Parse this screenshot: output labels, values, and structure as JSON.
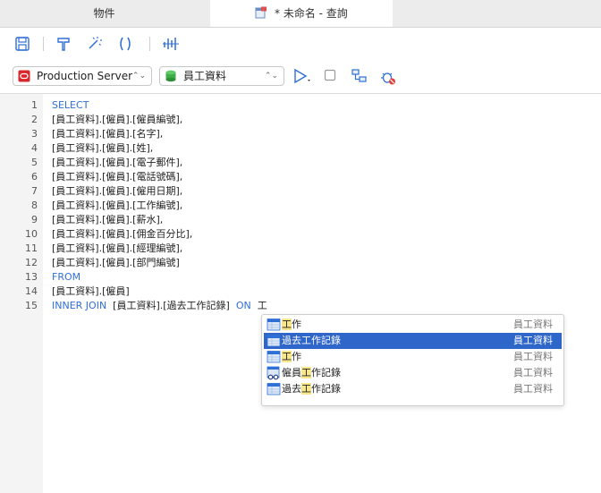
{
  "tabs": {
    "objects": "物件",
    "query": "* 未命名 - 查詢"
  },
  "toolbar": {
    "connection": "Production Server",
    "database": "員工資料"
  },
  "editor": {
    "lines": [
      {
        "num": "1",
        "parts": [
          {
            "t": "SELECT",
            "kw": true
          }
        ]
      },
      {
        "num": "2",
        "parts": [
          {
            "t": "[員工資料].[僱員].[僱員編號],",
            "kw": false
          }
        ]
      },
      {
        "num": "3",
        "parts": [
          {
            "t": "[員工資料].[僱員].[名字],",
            "kw": false
          }
        ]
      },
      {
        "num": "4",
        "parts": [
          {
            "t": "[員工資料].[僱員].[姓],",
            "kw": false
          }
        ]
      },
      {
        "num": "5",
        "parts": [
          {
            "t": "[員工資料].[僱員].[電子郵件],",
            "kw": false
          }
        ]
      },
      {
        "num": "6",
        "parts": [
          {
            "t": "[員工資料].[僱員].[電話號碼],",
            "kw": false
          }
        ]
      },
      {
        "num": "7",
        "parts": [
          {
            "t": "[員工資料].[僱員].[僱用日期],",
            "kw": false
          }
        ]
      },
      {
        "num": "8",
        "parts": [
          {
            "t": "[員工資料].[僱員].[工作編號],",
            "kw": false
          }
        ]
      },
      {
        "num": "9",
        "parts": [
          {
            "t": "[員工資料].[僱員].[薪水],",
            "kw": false
          }
        ]
      },
      {
        "num": "10",
        "parts": [
          {
            "t": "[員工資料].[僱員].[佣金百分比],",
            "kw": false
          }
        ]
      },
      {
        "num": "11",
        "parts": [
          {
            "t": "[員工資料].[僱員].[經理編號],",
            "kw": false
          }
        ]
      },
      {
        "num": "12",
        "parts": [
          {
            "t": "[員工資料].[僱員].[部門編號]",
            "kw": false
          }
        ]
      },
      {
        "num": "13",
        "parts": [
          {
            "t": "FROM",
            "kw": true
          }
        ]
      },
      {
        "num": "14",
        "parts": [
          {
            "t": "[員工資料].[僱員]",
            "kw": false
          }
        ]
      },
      {
        "num": "15",
        "parts": [
          {
            "t": "INNER JOIN",
            "kw": true
          },
          {
            "t": "  [員工資料].[過去工作記錄]  ",
            "kw": false
          },
          {
            "t": "ON",
            "kw": true
          },
          {
            "t": "  工",
            "kw": false
          }
        ]
      }
    ]
  },
  "autocomplete": {
    "items": [
      {
        "pre": "",
        "match": "工",
        "post": "作",
        "schema": "員工資料",
        "icon": "table-icon",
        "selected": false
      },
      {
        "pre": "過去工作記錄",
        "match": "",
        "post": "",
        "schema": "員工資料",
        "icon": "table-icon",
        "selected": true
      },
      {
        "pre": "",
        "match": "工",
        "post": "作",
        "schema": "員工資料",
        "icon": "table-icon",
        "selected": false
      },
      {
        "pre": "僱員",
        "match": "工",
        "post": "作記錄",
        "schema": "員工資料",
        "icon": "view-icon",
        "selected": false
      },
      {
        "pre": "過去",
        "match": "工",
        "post": "作記錄",
        "schema": "員工資料",
        "icon": "table-icon",
        "selected": false
      }
    ]
  },
  "colors": {
    "keyword": "#2f6fd6",
    "selection": "#2f66c9",
    "match_highlight": "#f7e78a"
  }
}
